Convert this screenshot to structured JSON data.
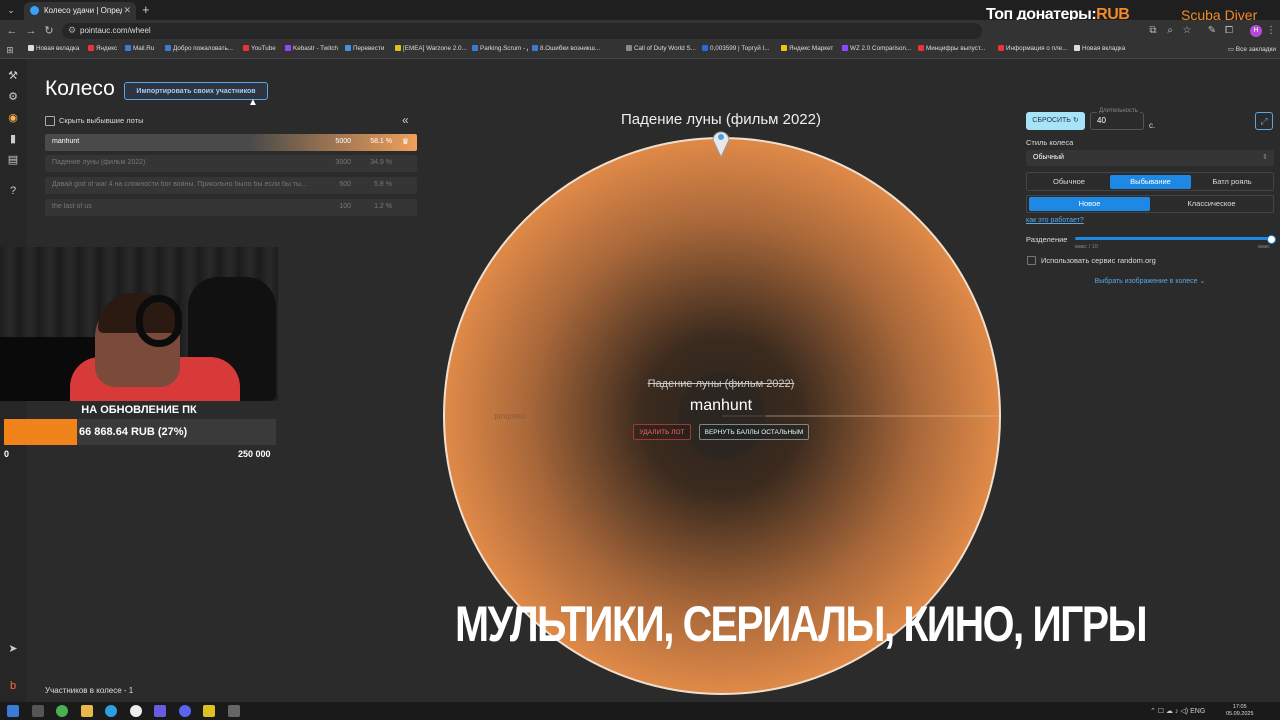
{
  "browser": {
    "tab_title": "Колесо удачи | Определите п",
    "url": "pointauc.com/wheel",
    "profile_initial": "H",
    "bookmarks": [
      "Новая вкладка",
      "Яндекс",
      "Mail.Ru",
      "Добро пожаловать...",
      "YouTube",
      "Kebastr - Twitch",
      "Перевести",
      "[EMEA] Warzone 2.0...",
      "Parking.Scrum - До...",
      "8.Ошибки возникш...",
      "Call of Duty World S...",
      "0,003599 | Торгуй I...",
      "Яндекс Маркет",
      "WZ 2.0 Comparison...",
      "Минцифры выпуст...",
      "Информация о пле...",
      "Новая вкладка"
    ],
    "all_bookmarks": "Все закладки"
  },
  "stream_overlay": {
    "top_donors_label": "Топ донатеры:",
    "top_donors_currency": "RUB",
    "streamer_name": "Scuba Diver",
    "caption": "МУЛЬТИКИ, СЕРИАЛЫ, КИНО, ИГРЫ",
    "goal": {
      "title": "НА ОБНОВЛЕНИЕ ПК",
      "progress_text": "66 868.64 RUB (27%)",
      "progress_fraction": 0.27,
      "min": "0",
      "max": "250 000"
    }
  },
  "page": {
    "title": "Колесо",
    "import_button": "Импортировать своих участников",
    "hide_dropped_label": "Скрыть выбывшие лоты",
    "participants_count": "Участников в колесе - 1"
  },
  "lots": [
    {
      "name": "manhunt",
      "amount": "5000",
      "percent": "58.1 %",
      "dropped": false
    },
    {
      "name": "Падение луны (фильм 2022)",
      "amount": "3000",
      "percent": "34.9 %",
      "dropped": true
    },
    {
      "name": "Давай god of war 4 на сложности бог войны. Прикольно было бы если бы ты...",
      "amount": "500",
      "percent": "5.8 %",
      "dropped": true
    },
    {
      "name": "the last of us",
      "amount": "100",
      "percent": "1.2 %",
      "dropped": true
    }
  ],
  "wheel": {
    "winner_top": "Падение луны (фильм 2022)",
    "segment_label": "manhunt",
    "center_struck": "Падение луны (фильм 2022)",
    "center_name": "manhunt",
    "delete_lot": "УДАЛИТЬ ЛОТ",
    "return_points": "ВЕРНУТЬ БАЛЛЫ ОСТАЛЬНЫМ",
    "color": "#e08a48"
  },
  "settings": {
    "reset_button": "СБРОСИТЬ",
    "duration_label": "Длительность",
    "duration_value": "40",
    "duration_unit": "с.",
    "style_label": "Стиль колеса",
    "style_value": "Обычный",
    "modes": [
      "Обычное",
      "Выбывание",
      "Батл рояль"
    ],
    "selected_mode": "Выбывание",
    "submodes": [
      "Новое",
      "Классическое"
    ],
    "selected_submode": "Новое",
    "how_it_works": "как это работает?",
    "split_label": "Разделение",
    "split_min": "макс / 10",
    "split_max": "макс",
    "split_value_fraction": 1.0,
    "random_org_label": "Использовать сервис random.org",
    "image_select": "Выбрать изображение в колесе"
  },
  "taskbar": {
    "lang": "ENG",
    "time": "17:05",
    "date": "05.09.2025"
  }
}
